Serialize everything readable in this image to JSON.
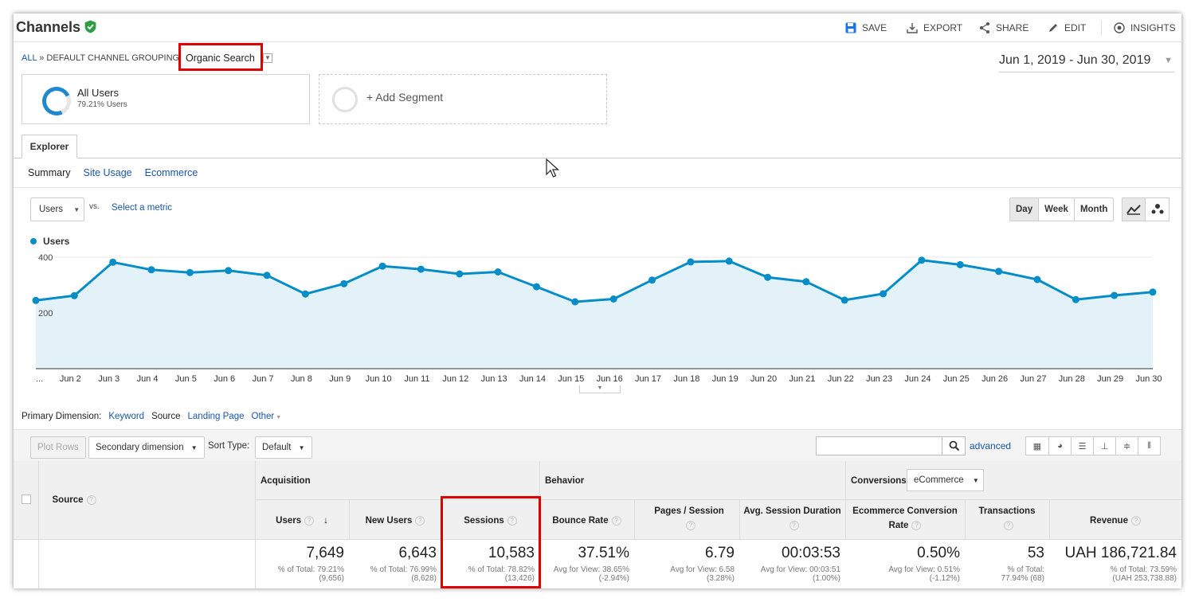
{
  "header": {
    "title": "Channels",
    "actions": [
      "SAVE",
      "EXPORT",
      "SHARE",
      "EDIT",
      "INSIGHTS"
    ]
  },
  "breadcrumb": {
    "all": "ALL",
    "sep": "»",
    "grouping": "DEFAULT CHANNEL GROUPING:",
    "value": "Organic Search"
  },
  "date_range": "Jun 1, 2019 - Jun 30, 2019",
  "segments": {
    "active_name": "All Users",
    "active_sub": "79.21% Users",
    "add": "+ Add Segment"
  },
  "explorer": {
    "tab": "Explorer",
    "subtabs": [
      "Summary",
      "Site Usage",
      "Ecommerce"
    ]
  },
  "chart_controls": {
    "metric": "Users",
    "vs": "vs.",
    "select_metric": "Select a metric",
    "granularity": [
      "Day",
      "Week",
      "Month"
    ]
  },
  "chart_data": {
    "type": "area",
    "series": [
      {
        "name": "Users",
        "values": [
          245,
          262,
          382,
          355,
          345,
          352,
          335,
          268,
          305,
          368,
          357,
          340,
          347,
          294,
          240,
          250,
          318,
          383,
          386,
          328,
          312,
          246,
          269,
          389,
          373,
          349,
          320,
          248,
          263,
          275
        ]
      }
    ],
    "x": [
      "Jun 1",
      "Jun 2",
      "Jun 3",
      "Jun 4",
      "Jun 5",
      "Jun 6",
      "Jun 7",
      "Jun 8",
      "Jun 9",
      "Jun 10",
      "Jun 11",
      "Jun 12",
      "Jun 13",
      "Jun 14",
      "Jun 15",
      "Jun 16",
      "Jun 17",
      "Jun 18",
      "Jun 19",
      "Jun 20",
      "Jun 21",
      "Jun 22",
      "Jun 23",
      "Jun 24",
      "Jun 25",
      "Jun 26",
      "Jun 27",
      "Jun 28",
      "Jun 29",
      "Jun 30"
    ],
    "x_tick_labels": [
      "...",
      "Jun 2",
      "Jun 3",
      "Jun 4",
      "Jun 5",
      "Jun 6",
      "Jun 7",
      "Jun 8",
      "Jun 9",
      "Jun 10",
      "Jun 11",
      "Jun 12",
      "Jun 13",
      "Jun 14",
      "Jun 15",
      "Jun 16",
      "Jun 17",
      "Jun 18",
      "Jun 19",
      "Jun 20",
      "Jun 21",
      "Jun 22",
      "Jun 23",
      "Jun 24",
      "Jun 25",
      "Jun 26",
      "Jun 27",
      "Jun 28",
      "Jun 29",
      "Jun 30"
    ],
    "y_ticks": [
      400,
      200
    ],
    "ylim": [
      0,
      400
    ],
    "grid": true,
    "legend": "top-left",
    "colors": {
      "line": "#058dc7",
      "fill": "#e3f1f9"
    }
  },
  "primary_dimension": {
    "label": "Primary Dimension:",
    "options": [
      "Keyword",
      "Source",
      "Landing Page",
      "Other"
    ],
    "selected": "Source"
  },
  "table_toolbar": {
    "plot_rows": "Plot Rows",
    "secondary": "Secondary dimension",
    "sort_type_label": "Sort Type:",
    "sort_type": "Default",
    "advanced": "advanced"
  },
  "table": {
    "source_header": "Source",
    "groups": {
      "acquisition": "Acquisition",
      "behavior": "Behavior",
      "conversions": "Conversions",
      "conversions_select": "eCommerce"
    },
    "columns": [
      "Users",
      "New Users",
      "Sessions",
      "Bounce Rate",
      "Pages / Session",
      "Avg. Session Duration",
      "Ecommerce Conversion Rate",
      "Transactions",
      "Revenue"
    ],
    "totals": [
      {
        "value": "7,649",
        "l1": "% of Total: 79.21%",
        "l2": "(9,656)"
      },
      {
        "value": "6,643",
        "l1": "% of Total: 76.99%",
        "l2": "(8,628)"
      },
      {
        "value": "10,583",
        "l1": "% of Total: 78.82%",
        "l2": "(13,426)"
      },
      {
        "value": "37.51%",
        "l1": "Avg for View: 38.65%",
        "l2": "(-2.94%)"
      },
      {
        "value": "6.79",
        "l1": "Avg for View: 6.58",
        "l2": "(3.28%)"
      },
      {
        "value": "00:03:53",
        "l1": "Avg for View: 00:03:51",
        "l2": "(1.00%)"
      },
      {
        "value": "0.50%",
        "l1": "Avg for View: 0.51%",
        "l2": "(-1.12%)"
      },
      {
        "value": "53",
        "l1": "% of Total:",
        "l2": "77.94% (68)"
      },
      {
        "value": "UAH 186,721.84",
        "l1": "% of Total: 73.59%",
        "l2": "(UAH 253,738.88)"
      }
    ]
  },
  "colors": {
    "accent": "#058dc7",
    "link": "#1a56a6",
    "highlight": "#e00000",
    "verified": "#2e9e44"
  }
}
